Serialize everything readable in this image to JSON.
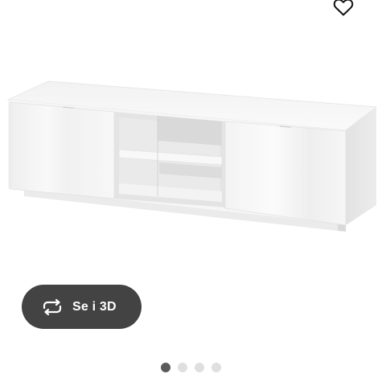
{
  "favorite": {
    "icon": "heart-outline-icon"
  },
  "product_image": {
    "alt": "",
    "colors": {
      "body": "#f7f7f7",
      "shadow": "#dcdcdc"
    }
  },
  "view_3d": {
    "label": "Se i 3D",
    "icon": "rotate-arrows-icon",
    "background": "#434343"
  },
  "carousel": {
    "total": 4,
    "active_index": 0,
    "colors": {
      "active": "#5a5a5a",
      "inactive": "#dfdfdf"
    }
  }
}
